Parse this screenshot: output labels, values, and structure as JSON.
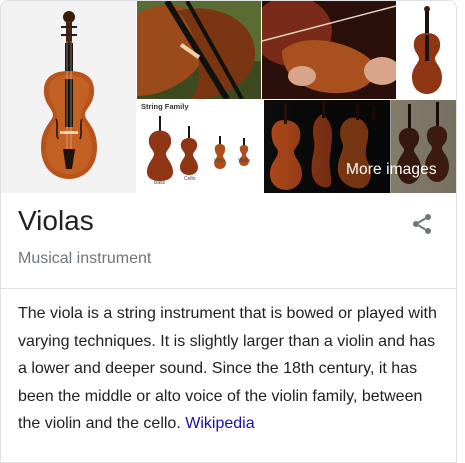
{
  "images": {
    "tiles": [
      {
        "name": "viola-main-image"
      },
      {
        "name": "viola-closeup-image"
      },
      {
        "name": "viola-player-image"
      },
      {
        "name": "viola-single-image"
      },
      {
        "name": "string-family-image"
      },
      {
        "name": "viola-group-image"
      },
      {
        "name": "viola-pair-image"
      }
    ],
    "family_caption": "String Family",
    "family_labels": [
      "Bass",
      "Cello",
      "Viola",
      "Violin"
    ],
    "more_images_label": "More images"
  },
  "header": {
    "title": "Violas",
    "subtitle": "Musical instrument",
    "share_icon": "share-icon"
  },
  "description": {
    "text": "The viola is a string instrument that is bowed or played with varying techniques. It is slightly larger than a violin and has a lower and deeper sound. Since the 18th century, it has been the middle or alto voice of the violin family, between the violin and the cello.",
    "source_link": "Wikipedia"
  },
  "colors": {
    "link": "#1a0dab",
    "title": "#202124",
    "subtitle": "#70757a",
    "divider": "#dfe1e5"
  }
}
